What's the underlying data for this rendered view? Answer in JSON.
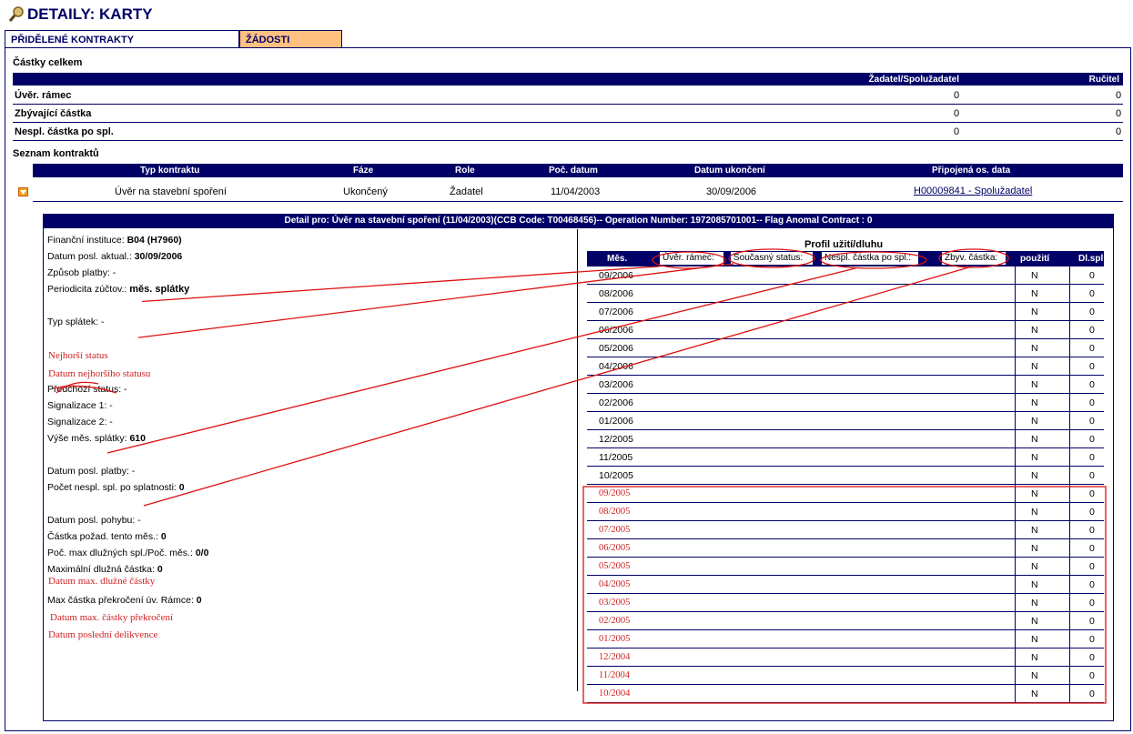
{
  "page": {
    "title": "DETAILY: KARTY"
  },
  "tabs": [
    {
      "label": "PŘIDĚLENÉ KONTRAKTY"
    },
    {
      "label": "ŽÁDOSTI"
    }
  ],
  "totals": {
    "heading": "Částky celkem",
    "col_applicant": "Žadatel/Spolužadatel",
    "col_guarantor": "Ručitel",
    "rows": [
      {
        "label": "Úvěr. rámec",
        "applicant": "0",
        "guarantor": "0"
      },
      {
        "label": "Zbývající částka",
        "applicant": "0",
        "guarantor": "0"
      },
      {
        "label": "Nespl. částka po spl.",
        "applicant": "0",
        "guarantor": "0"
      }
    ]
  },
  "contracts": {
    "heading": "Seznam kontraktů",
    "headers": [
      "Typ kontraktu",
      "Fáze",
      "Role",
      "Poč. datum",
      "Datum ukončení",
      "Připojená os. data"
    ],
    "row": {
      "type": "Úvěr na stavební spoření",
      "phase": "Ukončený",
      "role": "Žadatel",
      "start": "11/04/2003",
      "end": "30/09/2006",
      "link": "H00009841 - Spolužadatel"
    }
  },
  "detail": {
    "header": "Detail pro: Úvěr na stavební spoření (11/04/2003)(CCB Code: T00468456)-- Operation Number: 1972085701001-- Flag Anomal Contract : 0",
    "fields": {
      "institution_label": "Finanční instituce:",
      "institution_value": "B04 (H7960)",
      "update_label": "Datum posl. aktual.:",
      "update_value": "30/09/2006",
      "payment_label": "Způsob platby: -",
      "period_label": "Periodicita zúčtov.:",
      "period_value": "měs. splátky",
      "type_label": "Typ splátek: -",
      "worst_status": "Nejhorší status",
      "worst_date": "Datum nejhoršího statusu",
      "prev_status": "Předchozí status: -",
      "signal1": "Signalizace 1: -",
      "signal2": "Signalizace 2: -",
      "monthly_label": "Výše měs. splátky:",
      "monthly_value": "610",
      "last_pay": "Datum posl. platby: -",
      "unpaid_label": "Počet nespl. spl. po splatnosti:",
      "unpaid_value": "0",
      "last_move": "Datum posl. pohybu: -",
      "req_label": "Částka požad. tento měs.:",
      "req_value": "0",
      "max_label": "Poč. max dlužných spl./Poč. měs.:",
      "max_value": "0/0",
      "maxdebt_label": "Maximální dlužná částka:",
      "maxdebt_value": "0",
      "maxdebt_date": "Datum max. dlužné částky",
      "overlimit_label": "Max částka překročení úv. Rámce:",
      "overlimit_value": "0",
      "overlimit_date": "Datum max. částky překročení",
      "last_delinq": "Datum poslední delikvence"
    },
    "profile": {
      "title": "Profil užití/dluhu",
      "headers": {
        "month": "Měs.",
        "limit": "Úvěr. rámec:",
        "status": "Současný status:",
        "unpaid": "Nespl. částka po spl.:",
        "remaining": "Zbyv. částka:",
        "used": "použití",
        "dl": "Dl.spl"
      },
      "rows": [
        {
          "m": "09/2006",
          "n": "N",
          "z": "0"
        },
        {
          "m": "08/2006",
          "n": "N",
          "z": "0"
        },
        {
          "m": "07/2006",
          "n": "N",
          "z": "0"
        },
        {
          "m": "06/2006",
          "n": "N",
          "z": "0"
        },
        {
          "m": "05/2006",
          "n": "N",
          "z": "0"
        },
        {
          "m": "04/2006",
          "n": "N",
          "z": "0"
        },
        {
          "m": "03/2006",
          "n": "N",
          "z": "0"
        },
        {
          "m": "02/2006",
          "n": "N",
          "z": "0"
        },
        {
          "m": "01/2006",
          "n": "N",
          "z": "0"
        },
        {
          "m": "12/2005",
          "n": "N",
          "z": "0"
        },
        {
          "m": "11/2005",
          "n": "N",
          "z": "0"
        },
        {
          "m": "10/2005",
          "n": "N",
          "z": "0"
        },
        {
          "m": "09/2005",
          "n": "N",
          "z": "0"
        },
        {
          "m": "08/2005",
          "n": "N",
          "z": "0"
        },
        {
          "m": "07/2005",
          "n": "N",
          "z": "0"
        },
        {
          "m": "06/2005",
          "n": "N",
          "z": "0"
        },
        {
          "m": "05/2005",
          "n": "N",
          "z": "0"
        },
        {
          "m": "04/2005",
          "n": "N",
          "z": "0"
        },
        {
          "m": "03/2005",
          "n": "N",
          "z": "0"
        },
        {
          "m": "02/2005",
          "n": "N",
          "z": "0"
        },
        {
          "m": "01/2005",
          "n": "N",
          "z": "0"
        },
        {
          "m": "12/2004",
          "n": "N",
          "z": "0"
        },
        {
          "m": "11/2004",
          "n": "N",
          "z": "0"
        },
        {
          "m": "10/2004",
          "n": "N",
          "z": "0"
        }
      ]
    }
  },
  "colors": {
    "navy": "#000066",
    "tab_orange": "#ffc080",
    "annotation_red": "#cc2222"
  }
}
